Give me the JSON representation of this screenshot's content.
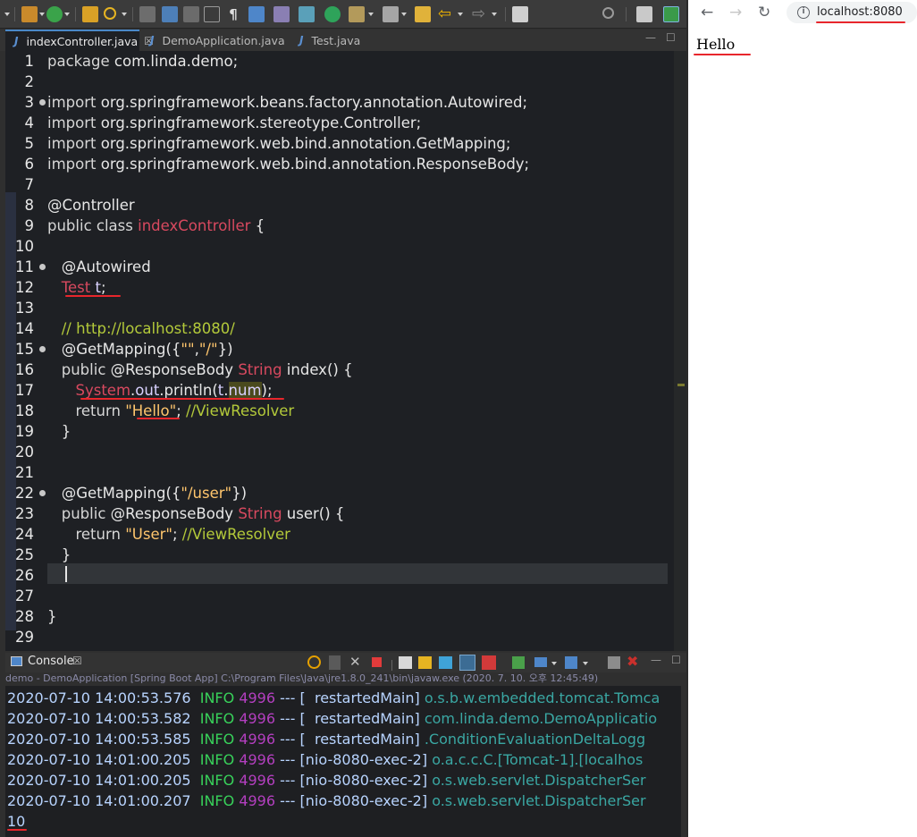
{
  "editor_tabs": [
    {
      "label": "indexController.java",
      "active": true,
      "closable": true
    },
    {
      "label": "DemoApplication.java",
      "active": false,
      "closable": false
    },
    {
      "label": "Test.java",
      "active": false,
      "closable": false
    }
  ],
  "code_lines": [
    {
      "n": "1",
      "text": "package com.linda.demo;"
    },
    {
      "n": "2",
      "text": ""
    },
    {
      "n": "3",
      "text": "import org.springframework.beans.factory.annotation.Autowired;"
    },
    {
      "n": "4",
      "text": "import org.springframework.stereotype.Controller;"
    },
    {
      "n": "5",
      "text": "import org.springframework.web.bind.annotation.GetMapping;"
    },
    {
      "n": "6",
      "text": "import org.springframework.web.bind.annotation.ResponseBody;"
    },
    {
      "n": "7",
      "text": ""
    },
    {
      "n": "8",
      "text": "@Controller"
    },
    {
      "n": "9",
      "text": "public class indexController {"
    },
    {
      "n": "10",
      "text": ""
    },
    {
      "n": "11",
      "text": "@Autowired"
    },
    {
      "n": "12",
      "text": "Test t;"
    },
    {
      "n": "13",
      "text": ""
    },
    {
      "n": "14",
      "text": "// http://localhost:8080/"
    },
    {
      "n": "15",
      "text": "@GetMapping({\"\",\"/\"})"
    },
    {
      "n": "16",
      "text": "public @ResponseBody String index() {"
    },
    {
      "n": "17",
      "text": "System.out.println(t.num);"
    },
    {
      "n": "18",
      "text": "return \"Hello\"; //ViewResolver"
    },
    {
      "n": "19",
      "text": "}"
    },
    {
      "n": "20",
      "text": ""
    },
    {
      "n": "21",
      "text": ""
    },
    {
      "n": "22",
      "text": "@GetMapping({\"/user\"})"
    },
    {
      "n": "23",
      "text": "public @ResponseBody String user() {"
    },
    {
      "n": "24",
      "text": "return \"User\"; //ViewResolver"
    },
    {
      "n": "25",
      "text": "}"
    },
    {
      "n": "26",
      "text": ""
    },
    {
      "n": "27",
      "text": ""
    },
    {
      "n": "28",
      "text": "}"
    },
    {
      "n": "29",
      "text": ""
    }
  ],
  "console": {
    "tab_label": "Console",
    "description": "demo - DemoApplication [Spring Boot App] C:\\Program Files\\Java\\jre1.8.0_241\\bin\\javaw.exe (2020. 7. 10. 오후 12:45:49)",
    "lines": [
      {
        "ts": "2020-07-10 14:00:53.576",
        "level": "INFO",
        "pid": "4996",
        "dash": "---",
        "thread": "[  restartedMain]",
        "logger": "o.s.b.w.embedded.tomcat.Tomca"
      },
      {
        "ts": "2020-07-10 14:00:53.582",
        "level": "INFO",
        "pid": "4996",
        "dash": "---",
        "thread": "[  restartedMain]",
        "logger": "com.linda.demo.DemoApplicatio"
      },
      {
        "ts": "2020-07-10 14:00:53.585",
        "level": "INFO",
        "pid": "4996",
        "dash": "---",
        "thread": "[  restartedMain]",
        "logger": ".ConditionEvaluationDeltaLogg"
      },
      {
        "ts": "2020-07-10 14:01:00.205",
        "level": "INFO",
        "pid": "4996",
        "dash": "---",
        "thread": "[nio-8080-exec-2]",
        "logger": "o.a.c.c.C.[Tomcat-1].[localhos"
      },
      {
        "ts": "2020-07-10 14:01:00.205",
        "level": "INFO",
        "pid": "4996",
        "dash": "---",
        "thread": "[nio-8080-exec-2]",
        "logger": "o.s.web.servlet.DispatcherSer"
      },
      {
        "ts": "2020-07-10 14:01:00.207",
        "level": "INFO",
        "pid": "4996",
        "dash": "---",
        "thread": "[nio-8080-exec-2]",
        "logger": "o.s.web.servlet.DispatcherSer"
      }
    ],
    "output": "10"
  },
  "browser": {
    "url": "localhost:8080",
    "page_text": "Hello"
  },
  "colors": {
    "annotation_red": "#e8262c",
    "eclipse_bg": "#1e2024",
    "console_level": "#38d15a",
    "console_pid": "#b33fbf",
    "console_logger": "#3aa7a3"
  }
}
